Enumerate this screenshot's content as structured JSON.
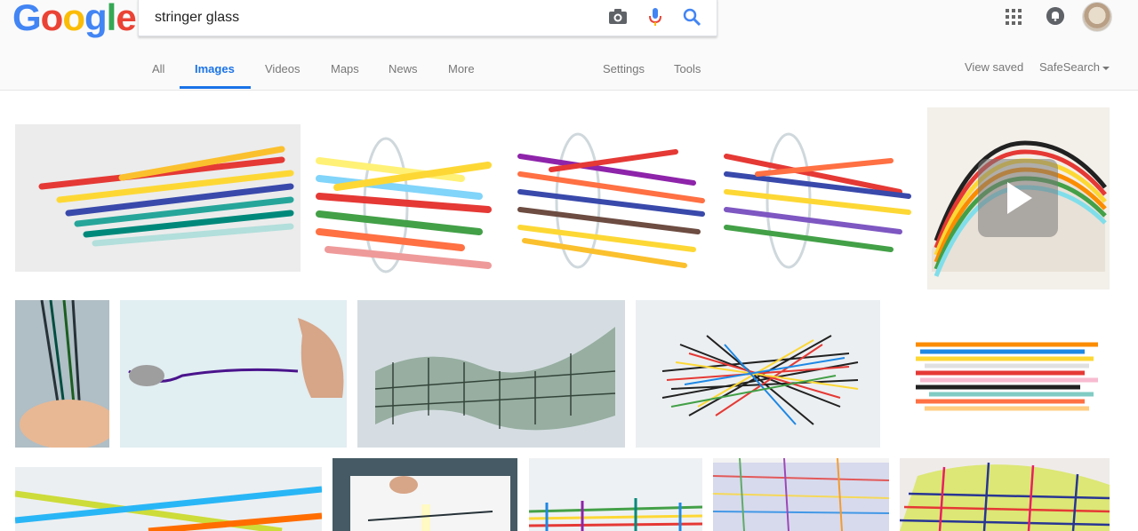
{
  "logo": {
    "letters": [
      "G",
      "o",
      "o",
      "g",
      "l",
      "e"
    ],
    "colors": [
      "#4285F4",
      "#EA4335",
      "#FBBC05",
      "#4285F4",
      "#34A853",
      "#EA4335"
    ]
  },
  "search": {
    "query": "stringer glass",
    "icons": [
      "camera-icon",
      "mic-icon",
      "search-icon"
    ]
  },
  "tabs": [
    {
      "label": "All"
    },
    {
      "label": "Images",
      "active": true
    },
    {
      "label": "Videos"
    },
    {
      "label": "Maps"
    },
    {
      "label": "News"
    },
    {
      "label": "More"
    }
  ],
  "tools": {
    "settings": "Settings",
    "tools": "Tools"
  },
  "right_links": {
    "view_saved": "View saved",
    "safesearch": "SafeSearch"
  },
  "header_icons": [
    "apps-icon",
    "notifications-icon",
    "avatar"
  ],
  "accent_color": "#1a73e8",
  "results": {
    "row1": [
      "glass-rods-bundle",
      "glass-rods-in-tube-1",
      "glass-rods-in-tube-2",
      "glass-rods-in-tube-3",
      "stringer-video-thumb"
    ],
    "row2": [
      "hand-holding-stringers",
      "pulling-stringer",
      "woven-plaid-glass",
      "tangled-stringer-nest",
      "colored-stringers-pile"
    ],
    "row3": [
      "blue-orange-rods",
      "torch-pulling-demo",
      "plaid-bowl-1",
      "plaid-bowl-2",
      "plaid-bowl-3"
    ]
  }
}
